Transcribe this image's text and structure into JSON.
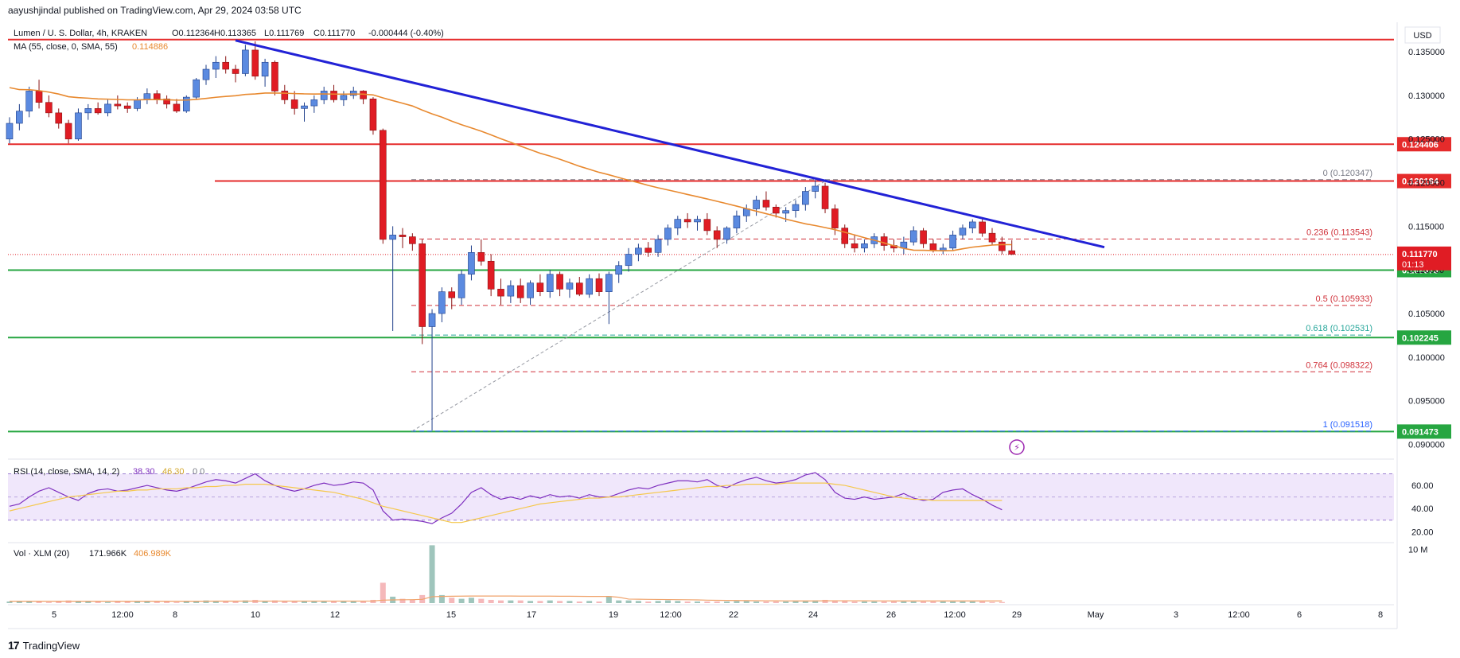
{
  "publisher": "aayushjindal published on TradingView.com, Apr 29, 2024 03:58 UTC",
  "brand": "TradingView",
  "colors": {
    "up": "#5b8ae0",
    "down": "#e01c24",
    "level_green": "#26a641",
    "level_red": "#e52b2b",
    "trend": "#2222d6",
    "ma": "#e8892f",
    "rsi": "#7e2fbf",
    "rsi_ma": "#f5c84c",
    "fib": "#d0313a"
  },
  "chart_data": {
    "type": "candlestick",
    "header": {
      "symbol": "Lumen / U. S. Dollar, 4h, KRAKEN",
      "o": "O0.112364",
      "h": "H0.113365",
      "l": "L0.111769",
      "c": "C0.111770",
      "change": "-0.000444 (-0.40%)"
    },
    "ma_legend": {
      "label": "MA (55, close, 0, SMA, 55)",
      "value": "0.114886"
    },
    "currency": "USD",
    "y_range": [
      0.0885,
      0.1382
    ],
    "y_ticks": [
      "0.135000",
      "0.130000",
      "0.125000",
      "0.120000",
      "0.115000",
      "0.110000",
      "0.105000",
      "0.100000",
      "0.095000",
      "0.090000"
    ],
    "x_ticks": [
      "5",
      "12:00",
      "8",
      "10",
      "12",
      "15",
      "17",
      "19",
      "12:00",
      "22",
      "24",
      "26",
      "12:00",
      "29",
      "May",
      "3",
      "12:00",
      "6",
      "8"
    ],
    "candles": [
      [
        0.125,
        0.1275,
        0.1245,
        0.1268
      ],
      [
        0.1268,
        0.129,
        0.126,
        0.1282
      ],
      [
        0.1282,
        0.131,
        0.1275,
        0.1305
      ],
      [
        0.1305,
        0.1318,
        0.1285,
        0.1292
      ],
      [
        0.1292,
        0.13,
        0.1275,
        0.128
      ],
      [
        0.128,
        0.1285,
        0.1262,
        0.1268
      ],
      [
        0.1268,
        0.1272,
        0.1245,
        0.125
      ],
      [
        0.125,
        0.1285,
        0.1248,
        0.128
      ],
      [
        0.128,
        0.129,
        0.1272,
        0.1285
      ],
      [
        0.1285,
        0.1292,
        0.1278,
        0.128
      ],
      [
        0.128,
        0.1295,
        0.1276,
        0.129
      ],
      [
        0.129,
        0.13,
        0.1284,
        0.1288
      ],
      [
        0.1288,
        0.1292,
        0.128,
        0.1285
      ],
      [
        0.1285,
        0.1298,
        0.1282,
        0.1295
      ],
      [
        0.1295,
        0.1308,
        0.129,
        0.1302
      ],
      [
        0.1302,
        0.1306,
        0.129,
        0.1296
      ],
      [
        0.1296,
        0.13,
        0.1285,
        0.129
      ],
      [
        0.129,
        0.1296,
        0.128,
        0.1282
      ],
      [
        0.1282,
        0.13,
        0.128,
        0.1298
      ],
      [
        0.1298,
        0.132,
        0.1295,
        0.1318
      ],
      [
        0.1318,
        0.1335,
        0.1312,
        0.133
      ],
      [
        0.133,
        0.1345,
        0.132,
        0.1338
      ],
      [
        0.1338,
        0.1345,
        0.1325,
        0.133
      ],
      [
        0.133,
        0.1335,
        0.1315,
        0.1325
      ],
      [
        0.1325,
        0.1358,
        0.1322,
        0.1352
      ],
      [
        0.1352,
        0.1362,
        0.1318,
        0.1322
      ],
      [
        0.1322,
        0.1342,
        0.131,
        0.1338
      ],
      [
        0.1338,
        0.134,
        0.13,
        0.1305
      ],
      [
        0.1305,
        0.1312,
        0.129,
        0.1295
      ],
      [
        0.1295,
        0.1305,
        0.1278,
        0.1285
      ],
      [
        0.1285,
        0.1292,
        0.127,
        0.1288
      ],
      [
        0.1288,
        0.13,
        0.128,
        0.1295
      ],
      [
        0.1295,
        0.131,
        0.129,
        0.1305
      ],
      [
        0.1305,
        0.1312,
        0.1292,
        0.1295
      ],
      [
        0.1295,
        0.1305,
        0.1288,
        0.13
      ],
      [
        0.13,
        0.131,
        0.1296,
        0.1305
      ],
      [
        0.1305,
        0.1306,
        0.129,
        0.1296
      ],
      [
        0.1296,
        0.1298,
        0.1255,
        0.126
      ],
      [
        0.126,
        0.1262,
        0.113,
        0.1135
      ],
      [
        0.1135,
        0.115,
        0.103,
        0.114
      ],
      [
        0.114,
        0.1148,
        0.1125,
        0.1138
      ],
      [
        0.1138,
        0.1142,
        0.1122,
        0.113
      ],
      [
        0.113,
        0.1135,
        0.1015,
        0.1035
      ],
      [
        0.1035,
        0.1055,
        0.0916,
        0.105
      ],
      [
        0.105,
        0.108,
        0.104,
        0.1075
      ],
      [
        0.1075,
        0.108,
        0.1055,
        0.1068
      ],
      [
        0.1068,
        0.11,
        0.106,
        0.1095
      ],
      [
        0.1095,
        0.1128,
        0.1088,
        0.112
      ],
      [
        0.112,
        0.1135,
        0.1105,
        0.111
      ],
      [
        0.111,
        0.1118,
        0.107,
        0.1078
      ],
      [
        0.1078,
        0.109,
        0.106,
        0.107
      ],
      [
        0.107,
        0.1088,
        0.1062,
        0.1082
      ],
      [
        0.1082,
        0.109,
        0.1062,
        0.1068
      ],
      [
        0.1068,
        0.1088,
        0.106,
        0.1085
      ],
      [
        0.1085,
        0.1095,
        0.107,
        0.1075
      ],
      [
        0.1075,
        0.11,
        0.1068,
        0.1095
      ],
      [
        0.1095,
        0.1098,
        0.107,
        0.1078
      ],
      [
        0.1078,
        0.109,
        0.1068,
        0.1085
      ],
      [
        0.1085,
        0.1092,
        0.107,
        0.1072
      ],
      [
        0.1072,
        0.1095,
        0.1068,
        0.109
      ],
      [
        0.109,
        0.1096,
        0.107,
        0.1075
      ],
      [
        0.1075,
        0.1098,
        0.1038,
        0.1095
      ],
      [
        0.1095,
        0.111,
        0.1085,
        0.1105
      ],
      [
        0.1105,
        0.1125,
        0.1098,
        0.1118
      ],
      [
        0.1118,
        0.113,
        0.111,
        0.1125
      ],
      [
        0.1125,
        0.1132,
        0.1115,
        0.112
      ],
      [
        0.112,
        0.114,
        0.1115,
        0.1135
      ],
      [
        0.1135,
        0.1152,
        0.1128,
        0.1148
      ],
      [
        0.1148,
        0.1162,
        0.114,
        0.1158
      ],
      [
        0.1158,
        0.1165,
        0.1148,
        0.1155
      ],
      [
        0.1155,
        0.1162,
        0.1145,
        0.1158
      ],
      [
        0.1158,
        0.1165,
        0.114,
        0.1145
      ],
      [
        0.1145,
        0.115,
        0.1125,
        0.1135
      ],
      [
        0.1135,
        0.115,
        0.113,
        0.1148
      ],
      [
        0.1148,
        0.1168,
        0.1142,
        0.1162
      ],
      [
        0.1162,
        0.1175,
        0.1155,
        0.117
      ],
      [
        0.117,
        0.1185,
        0.1162,
        0.118
      ],
      [
        0.118,
        0.119,
        0.1168,
        0.1172
      ],
      [
        0.1172,
        0.1175,
        0.116,
        0.1165
      ],
      [
        0.1165,
        0.1172,
        0.1155,
        0.1168
      ],
      [
        0.1168,
        0.118,
        0.116,
        0.1175
      ],
      [
        0.1175,
        0.1195,
        0.1168,
        0.119
      ],
      [
        0.119,
        0.1203,
        0.1182,
        0.1196
      ],
      [
        0.1196,
        0.12,
        0.1165,
        0.117
      ],
      [
        0.117,
        0.1175,
        0.114,
        0.1148
      ],
      [
        0.1148,
        0.1152,
        0.1125,
        0.113
      ],
      [
        0.113,
        0.114,
        0.112,
        0.1125
      ],
      [
        0.1125,
        0.1135,
        0.112,
        0.113
      ],
      [
        0.113,
        0.1142,
        0.1125,
        0.1138
      ],
      [
        0.1138,
        0.1142,
        0.1122,
        0.1128
      ],
      [
        0.1128,
        0.1135,
        0.112,
        0.1125
      ],
      [
        0.1125,
        0.1138,
        0.1118,
        0.1132
      ],
      [
        0.1132,
        0.115,
        0.1128,
        0.1145
      ],
      [
        0.1145,
        0.1148,
        0.1125,
        0.113
      ],
      [
        0.113,
        0.1135,
        0.112,
        0.1122
      ],
      [
        0.1122,
        0.113,
        0.1118,
        0.1125
      ],
      [
        0.1125,
        0.1145,
        0.1122,
        0.114
      ],
      [
        0.114,
        0.1152,
        0.1135,
        0.1148
      ],
      [
        0.1148,
        0.1158,
        0.1142,
        0.1155
      ],
      [
        0.1155,
        0.1158,
        0.1138,
        0.1142
      ],
      [
        0.1142,
        0.1148,
        0.1128,
        0.1132
      ],
      [
        0.1132,
        0.1138,
        0.1118,
        0.1122
      ],
      [
        0.1122,
        0.1134,
        0.1117,
        0.1118
      ]
    ],
    "levels": [
      {
        "price": 0.1364,
        "color": "red",
        "label": ""
      },
      {
        "price": 0.124406,
        "color": "red",
        "label": "0.124406"
      },
      {
        "price": 0.120184,
        "color": "red",
        "label": "0.120184"
      },
      {
        "price": 0.109973,
        "color": "green",
        "label": "0.109973"
      },
      {
        "price": 0.102245,
        "color": "green",
        "label": "0.102245"
      },
      {
        "price": 0.091473,
        "color": "green",
        "label": "0.091473"
      }
    ],
    "current_price": {
      "value": "0.111770",
      "countdown": "01:13"
    },
    "fib_levels": [
      {
        "ratio": "0",
        "value": "0.120347",
        "price": 0.120347,
        "color": "#787b86"
      },
      {
        "ratio": "0.236",
        "value": "0.113543",
        "price": 0.113543,
        "color": "#d0313a"
      },
      {
        "ratio": "0.5",
        "value": "0.105933",
        "price": 0.105933,
        "color": "#d0313a"
      },
      {
        "ratio": "0.618",
        "value": "0.102531",
        "price": 0.102531,
        "color": "#26a69a"
      },
      {
        "ratio": "0.764",
        "value": "0.098322",
        "price": 0.098322,
        "color": "#d0313a"
      },
      {
        "ratio": "1",
        "value": "0.091518",
        "price": 0.091518,
        "color": "#2962ff"
      }
    ],
    "rsi": {
      "legend": "RSI (14, close, SMA, 14, 2)",
      "value": "38.30",
      "ma_value": "46.30",
      "extra": "0  0",
      "y_range": [
        12,
        82
      ],
      "ticks": [
        "60.00",
        "40.00",
        "20.00"
      ],
      "values": [
        42,
        44,
        50,
        55,
        58,
        54,
        50,
        47,
        53,
        56,
        57,
        55,
        56,
        58,
        60,
        58,
        56,
        55,
        57,
        60,
        63,
        65,
        64,
        62,
        66,
        70,
        64,
        60,
        57,
        55,
        57,
        60,
        62,
        60,
        61,
        63,
        62,
        56,
        38,
        30,
        31,
        30,
        29,
        27,
        32,
        36,
        44,
        54,
        58,
        52,
        48,
        50,
        48,
        51,
        49,
        52,
        50,
        51,
        49,
        52,
        50,
        50,
        53,
        56,
        58,
        57,
        60,
        62,
        64,
        64,
        63,
        65,
        60,
        58,
        62,
        65,
        67,
        64,
        62,
        63,
        65,
        69,
        71,
        65,
        54,
        49,
        48,
        50,
        48,
        49,
        50,
        53,
        49,
        47,
        48,
        54,
        56,
        57,
        52,
        48,
        43,
        39
      ],
      "ma": [
        38,
        40,
        42,
        44,
        46,
        48,
        50,
        51,
        52,
        53,
        54,
        55,
        55,
        56,
        56,
        57,
        57,
        57,
        58,
        58,
        59,
        59,
        60,
        60,
        61,
        61,
        61,
        60,
        59,
        58,
        57,
        56,
        55,
        54,
        52,
        50,
        48,
        45,
        42,
        40,
        38,
        36,
        34,
        32,
        30,
        28,
        28,
        30,
        32,
        34,
        36,
        38,
        40,
        42,
        44,
        45,
        46,
        47,
        48,
        49,
        49,
        50,
        50,
        51,
        52,
        53,
        54,
        55,
        56,
        57,
        58,
        59,
        59,
        60,
        60,
        61,
        61,
        61,
        61,
        62,
        62,
        62,
        62,
        62,
        61,
        60,
        58,
        56,
        54,
        52,
        50,
        49,
        48,
        48,
        47,
        47,
        47,
        47,
        47,
        47,
        47,
        47
      ],
      "bands": [
        70,
        30
      ]
    },
    "volume": {
      "legend": "Vol · XLM (20)",
      "value": "171.966K",
      "ma_value": "406.989K",
      "tick": "10 M",
      "y_max": 11000000,
      "values": [
        0.3,
        0.4,
        0.3,
        0.3,
        0.2,
        0.3,
        0.5,
        0.4,
        0.3,
        0.3,
        0.2,
        0.3,
        0.3,
        0.4,
        0.3,
        0.3,
        0.3,
        0.2,
        0.3,
        0.4,
        0.5,
        0.4,
        0.3,
        0.3,
        0.5,
        0.6,
        0.4,
        0.5,
        0.4,
        0.3,
        0.3,
        0.3,
        0.4,
        0.3,
        0.3,
        0.3,
        0.3,
        0.6,
        3.8,
        1.2,
        0.8,
        0.6,
        1.5,
        10.8,
        1.5,
        1.0,
        0.8,
        1.0,
        0.8,
        0.6,
        0.5,
        0.5,
        0.5,
        0.4,
        0.4,
        0.5,
        0.4,
        0.4,
        0.3,
        0.4,
        0.3,
        1.3,
        0.5,
        0.5,
        0.4,
        0.3,
        0.4,
        0.5,
        0.4,
        0.3,
        0.3,
        0.3,
        0.3,
        0.3,
        0.4,
        0.4,
        0.3,
        0.3,
        0.3,
        0.3,
        0.4,
        0.4,
        0.5,
        0.6,
        0.5,
        0.4,
        0.3,
        0.3,
        0.3,
        0.3,
        0.3,
        0.3,
        0.3,
        0.3,
        0.3,
        0.3,
        0.3,
        0.3,
        0.3,
        0.3,
        0.2,
        0.2
      ],
      "unit": 1000000,
      "ma": [
        0.35,
        0.35,
        0.35,
        0.35,
        0.35,
        0.35,
        0.35,
        0.35,
        0.35,
        0.35,
        0.35,
        0.35,
        0.35,
        0.35,
        0.35,
        0.35,
        0.35,
        0.35,
        0.35,
        0.35,
        0.36,
        0.37,
        0.37,
        0.37,
        0.38,
        0.38,
        0.38,
        0.38,
        0.38,
        0.38,
        0.38,
        0.38,
        0.38,
        0.38,
        0.38,
        0.38,
        0.38,
        0.4,
        0.55,
        0.6,
        0.62,
        0.64,
        0.7,
        1.2,
        1.25,
        1.28,
        1.3,
        1.32,
        1.32,
        1.32,
        1.32,
        1.32,
        1.3,
        1.3,
        1.3,
        1.3,
        1.28,
        1.28,
        1.26,
        1.25,
        1.24,
        1.24,
        1.1,
        0.75,
        0.72,
        0.7,
        0.68,
        0.66,
        0.64,
        0.62,
        0.6,
        0.55,
        0.52,
        0.5,
        0.48,
        0.46,
        0.45,
        0.44,
        0.43,
        0.42,
        0.41,
        0.41,
        0.42,
        0.43,
        0.44,
        0.44,
        0.44,
        0.43,
        0.42,
        0.42,
        0.41,
        0.41,
        0.41,
        0.41,
        0.41,
        0.41,
        0.41,
        0.41,
        0.41,
        0.41,
        0.41,
        0.41
      ]
    }
  }
}
